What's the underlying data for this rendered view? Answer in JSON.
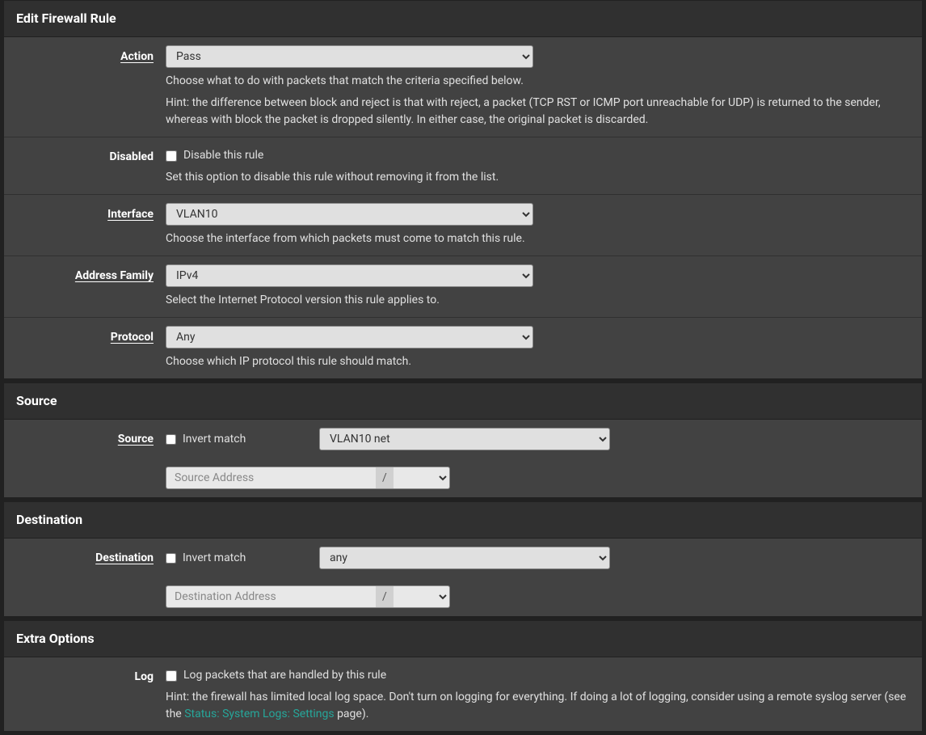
{
  "panels": {
    "edit": {
      "title": "Edit Firewall Rule",
      "action": {
        "label": "Action",
        "value": "Pass",
        "help": "Choose what to do with packets that match the criteria specified below.",
        "hint": "Hint: the difference between block and reject is that with reject, a packet (TCP RST or ICMP port unreachable for UDP) is returned to the sender, whereas with block the packet is dropped silently. In either case, the original packet is discarded."
      },
      "disabled": {
        "label": "Disabled",
        "checkbox_label": "Disable this rule",
        "help": "Set this option to disable this rule without removing it from the list."
      },
      "interface": {
        "label": "Interface",
        "value": "VLAN10",
        "help": "Choose the interface from which packets must come to match this rule."
      },
      "addressfamily": {
        "label": "Address Family",
        "value": "IPv4",
        "help": "Select the Internet Protocol version this rule applies to."
      },
      "protocol": {
        "label": "Protocol",
        "value": "Any",
        "help": "Choose which IP protocol this rule should match."
      }
    },
    "source": {
      "title": "Source",
      "label": "Source",
      "invert_label": "Invert match",
      "type_value": "VLAN10 net",
      "addr_placeholder": "Source Address",
      "slash": "/",
      "mask_value": ""
    },
    "destination": {
      "title": "Destination",
      "label": "Destination",
      "invert_label": "Invert match",
      "type_value": "any",
      "addr_placeholder": "Destination Address",
      "slash": "/",
      "mask_value": ""
    },
    "extra": {
      "title": "Extra Options",
      "log": {
        "label": "Log",
        "checkbox_label": "Log packets that are handled by this rule",
        "hint_pre": "Hint: the firewall has limited local log space. Don't turn on logging for everything. If doing a lot of logging, consider using a remote syslog server (see the ",
        "link_text": "Status: System Logs: Settings",
        "hint_post": " page)."
      }
    }
  }
}
